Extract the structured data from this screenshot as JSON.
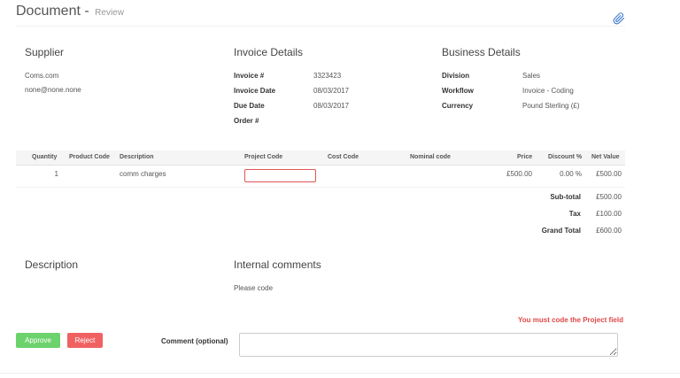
{
  "header": {
    "title": "Document",
    "separator": "-",
    "subtitle": "Review",
    "attach_icon": "paperclip-icon",
    "accent_color": "#4a7fd0"
  },
  "supplier": {
    "heading": "Supplier",
    "name": "Coms.com",
    "email": "none@none.none"
  },
  "invoice_details": {
    "heading": "Invoice Details",
    "fields": [
      {
        "label": "Invoice #",
        "value": "3323423"
      },
      {
        "label": "Invoice Date",
        "value": "08/03/2017"
      },
      {
        "label": "Due Date",
        "value": "08/03/2017"
      },
      {
        "label": "Order #",
        "value": ""
      }
    ]
  },
  "business_details": {
    "heading": "Business Details",
    "fields": [
      {
        "label": "Division",
        "value": "Sales"
      },
      {
        "label": "Workflow",
        "value": "Invoice - Coding"
      },
      {
        "label": "Currency",
        "value": "Pound Sterling (£)"
      }
    ]
  },
  "lines_table": {
    "columns": [
      "Quantity",
      "Product Code",
      "Description",
      "Project Code",
      "Cost Code",
      "Nominal code",
      "Price",
      "Discount %",
      "Net Value"
    ],
    "rows": [
      {
        "quantity": "1",
        "product_code": "",
        "description": "comm charges",
        "project_code": "",
        "cost_code": "",
        "nominal_code": "",
        "price": "£500.00",
        "discount": "0.00 %",
        "net_value": "£500.00"
      }
    ]
  },
  "totals": [
    {
      "label": "Sub-total",
      "value": "£500.00"
    },
    {
      "label": "Tax",
      "value": "£100.00"
    },
    {
      "label": "Grand Total",
      "value": "£600.00"
    }
  ],
  "description": {
    "heading": "Description"
  },
  "internal_comments": {
    "heading": "Internal comments",
    "text": "Please code"
  },
  "validation": {
    "error": "You must code the Project field",
    "error_color": "#e04848"
  },
  "actions": {
    "approve_label": "Approve",
    "approve_color": "#6cd26c",
    "reject_label": "Reject",
    "reject_color": "#f06262",
    "comment_label": "Comment (optional)",
    "comment_value": ""
  }
}
